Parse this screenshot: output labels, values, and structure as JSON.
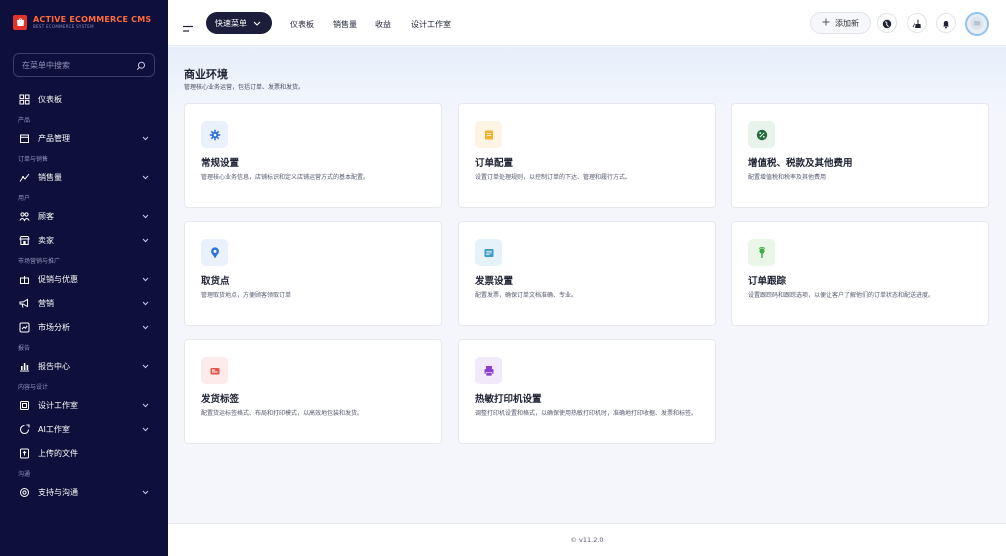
{
  "brand": {
    "title": "ACTIVE ECOMMERCE CMS",
    "subtitle": "BEST ECOMMERCE SYSTEM"
  },
  "sidebar": {
    "search_placeholder": "在菜单中搜索",
    "items": [
      {
        "label": "仪表板",
        "icon": "grid-icon",
        "chevron": false
      },
      {
        "section": "产品"
      },
      {
        "label": "产品管理",
        "icon": "product-icon",
        "chevron": true
      },
      {
        "section": "订单与销售"
      },
      {
        "label": "销售量",
        "icon": "sales-icon",
        "chevron": true
      },
      {
        "section": "用户"
      },
      {
        "label": "顾客",
        "icon": "customers-icon",
        "chevron": true
      },
      {
        "label": "卖家",
        "icon": "store-icon",
        "chevron": true
      },
      {
        "section": "市场营销与推广"
      },
      {
        "label": "促销与优惠",
        "icon": "gift-icon",
        "chevron": true
      },
      {
        "label": "营销",
        "icon": "megaphone-icon",
        "chevron": true
      },
      {
        "label": "市场分析",
        "icon": "chart-icon",
        "chevron": true
      },
      {
        "section": "报告"
      },
      {
        "label": "报告中心",
        "icon": "report-icon",
        "chevron": true
      },
      {
        "section": "内容与设计"
      },
      {
        "label": "设计工作室",
        "icon": "design-icon",
        "chevron": true
      },
      {
        "label": "AI工作室",
        "icon": "ai-icon",
        "chevron": true
      },
      {
        "label": "上传的文件",
        "icon": "upload-icon",
        "chevron": false
      },
      {
        "section": "沟通"
      },
      {
        "label": "支持与沟通",
        "icon": "support-icon",
        "chevron": true
      }
    ]
  },
  "topbar": {
    "quick_menu": "快速菜单",
    "links": [
      "仪表板",
      "销售量",
      "收益",
      "设计工作室"
    ],
    "add_new": "添加新",
    "icons": [
      "globe-icon",
      "cache-icon",
      "bell-icon"
    ]
  },
  "main": {
    "title": "商业环境",
    "description": "管理核心业务运营，包括订单、发票和发货。",
    "cards": [
      {
        "title": "常规设置",
        "description": "管理核心业务信息，店铺标识和定义店铺运营方式的基本配置。",
        "icon": "gear-icon",
        "bg": "#eaf1fc",
        "color": "#2f73d9"
      },
      {
        "title": "订单配置",
        "description": "设置订单处理规则，以控制订单的下达、管理和履行方式。",
        "icon": "receipt-icon",
        "bg": "#fdf4e3",
        "color": "#f3b22d"
      },
      {
        "title": "增值税、税款及其他费用",
        "description": "配置增值税和税率及其他费用",
        "icon": "percent-icon",
        "bg": "#e8f3ec",
        "color": "#1f6b3a"
      },
      {
        "title": "取货点",
        "description": "管理取货地点，方便顾客领取订单",
        "icon": "location-pin-icon",
        "bg": "#eaf1fc",
        "color": "#2f73d9"
      },
      {
        "title": "发票设置",
        "description": "配置发票，确保订单文档准确、专业。",
        "icon": "invoice-icon",
        "bg": "#e5f3f8",
        "color": "#3b9cc4"
      },
      {
        "title": "订单跟踪",
        "description": "设置跟踪码和跟踪选项，以便让客户了解他们的订单状态和配送进度。",
        "icon": "tracking-icon",
        "bg": "#e9f6e8",
        "color": "#3cb043"
      },
      {
        "title": "发货标签",
        "description": "配置货运标签格式、布局和打印模式，以高效地包装和发货。",
        "icon": "label-icon",
        "bg": "#fdeaea",
        "color": "#e2574c"
      },
      {
        "title": "热敏打印机设置",
        "description": "调整打印机设置和格式，以确保使用热敏打印机时，准确地打印收据、发票和标签。",
        "icon": "printer-icon",
        "bg": "#f2eafb",
        "color": "#8a3fd1"
      }
    ]
  },
  "footer": {
    "version": "© v11.2.0"
  }
}
